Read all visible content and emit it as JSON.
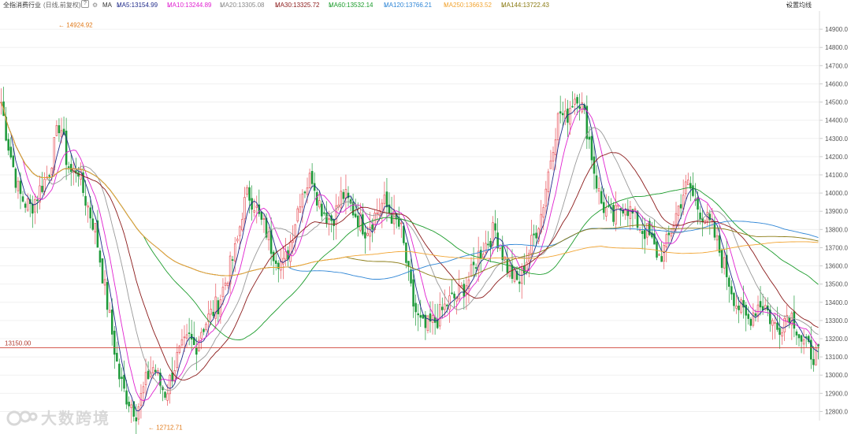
{
  "header": {
    "title": "全指消费行业",
    "period": "(日线,前复权)",
    "help_icon": "?",
    "settings_icon": "gear-icon",
    "ma_label": "MA",
    "ma5": "MA5:13154.99",
    "ma10": "MA10:13244.89",
    "ma20": "MA20:13305.08",
    "ma30": "MA30:13325.72",
    "ma60": "MA60:13532.14",
    "ma120": "MA120:13766.21",
    "ma250": "MA250:13663.52",
    "ma144": "MA144:13722.43",
    "arrow_down": "↓",
    "arrow_up": "↑",
    "settings_label": "设置均线",
    "settings_caret": "▾"
  },
  "colors": {
    "up": "#e8545c",
    "down": "#1f9a3b",
    "ma5": "#1f2a8a",
    "ma10": "#e021d0",
    "ma20": "#999999",
    "ma30": "#8b1a1a",
    "ma60": "#1c9c2c",
    "ma120": "#2f86d6",
    "ma250": "#f2a533",
    "ma144": "#8a7a12",
    "price_line": "#d0453a"
  },
  "annotations": {
    "high_label": "14924.92",
    "low_label": "12712.71",
    "price_line_label": "13150.00"
  },
  "watermark": {
    "text": "大数跨境"
  },
  "chart_data": {
    "type": "candlestick",
    "ylim": [
      12750,
      15000
    ],
    "y_ticks": [
      12800,
      12900,
      13000,
      13100,
      13200,
      13300,
      13400,
      13500,
      13600,
      13700,
      13800,
      13900,
      14000,
      14100,
      14200,
      14300,
      14400,
      14500,
      14600,
      14700,
      14800,
      14900
    ],
    "y_tick_labels": [
      "12800.0",
      "12900.0",
      "13000.0",
      "13100.0",
      "13200.0",
      "13300.0",
      "13400.0",
      "13500.0",
      "13600.0",
      "13700.0",
      "13800.0",
      "13900.0",
      "14000.0",
      "14100.0",
      "14200.0",
      "14300.0",
      "14400.0",
      "14500.0",
      "14600.0",
      "14700.0",
      "14800.0",
      "14900.0"
    ],
    "price_line": 13150.0,
    "high": 14924.92,
    "low": 12712.71,
    "candles_anchor_closes": [
      14500,
      14300,
      14150,
      14000,
      13950,
      13920,
      13980,
      14050,
      14100,
      14250,
      14400,
      14200,
      14100,
      14150,
      14000,
      13900,
      13800,
      13600,
      13400,
      13200,
      13000,
      12900,
      12850,
      12800,
      12900,
      13000,
      13050,
      12950,
      12900,
      13000,
      13100,
      13150,
      13200,
      13150,
      13250,
      13300,
      13350,
      13400,
      13500,
      13600,
      13700,
      13900,
      14000,
      13950,
      13850,
      13800,
      13700,
      13650,
      13600,
      13700,
      13850,
      14000,
      14050,
      14100,
      13950,
      13900,
      13850,
      13900,
      14000,
      13950,
      13900,
      13850,
      13800,
      13850,
      13900,
      13950,
      13900,
      13850,
      13800,
      13600,
      13400,
      13300,
      13250,
      13280,
      13300,
      13350,
      13400,
      13420,
      13450,
      13500,
      13550,
      13650,
      13700,
      13750,
      13800,
      13700,
      13600,
      13550,
      13500,
      13600,
      13700,
      13800,
      13900,
      14100,
      14300,
      14450,
      14400,
      14500,
      14550,
      14450,
      14300,
      14100,
      13950,
      13900,
      13850,
      13900,
      13950,
      13900,
      13850,
      13800,
      13780,
      13700,
      13650,
      13700,
      13800,
      13900,
      14000,
      14050,
      13950,
      13900,
      13850,
      13800,
      13700,
      13600,
      13500,
      13400,
      13350,
      13300,
      13350,
      13400,
      13380,
      13300,
      13250,
      13300,
      13350,
      13300,
      13200,
      13150,
      13120,
      13100
    ]
  }
}
